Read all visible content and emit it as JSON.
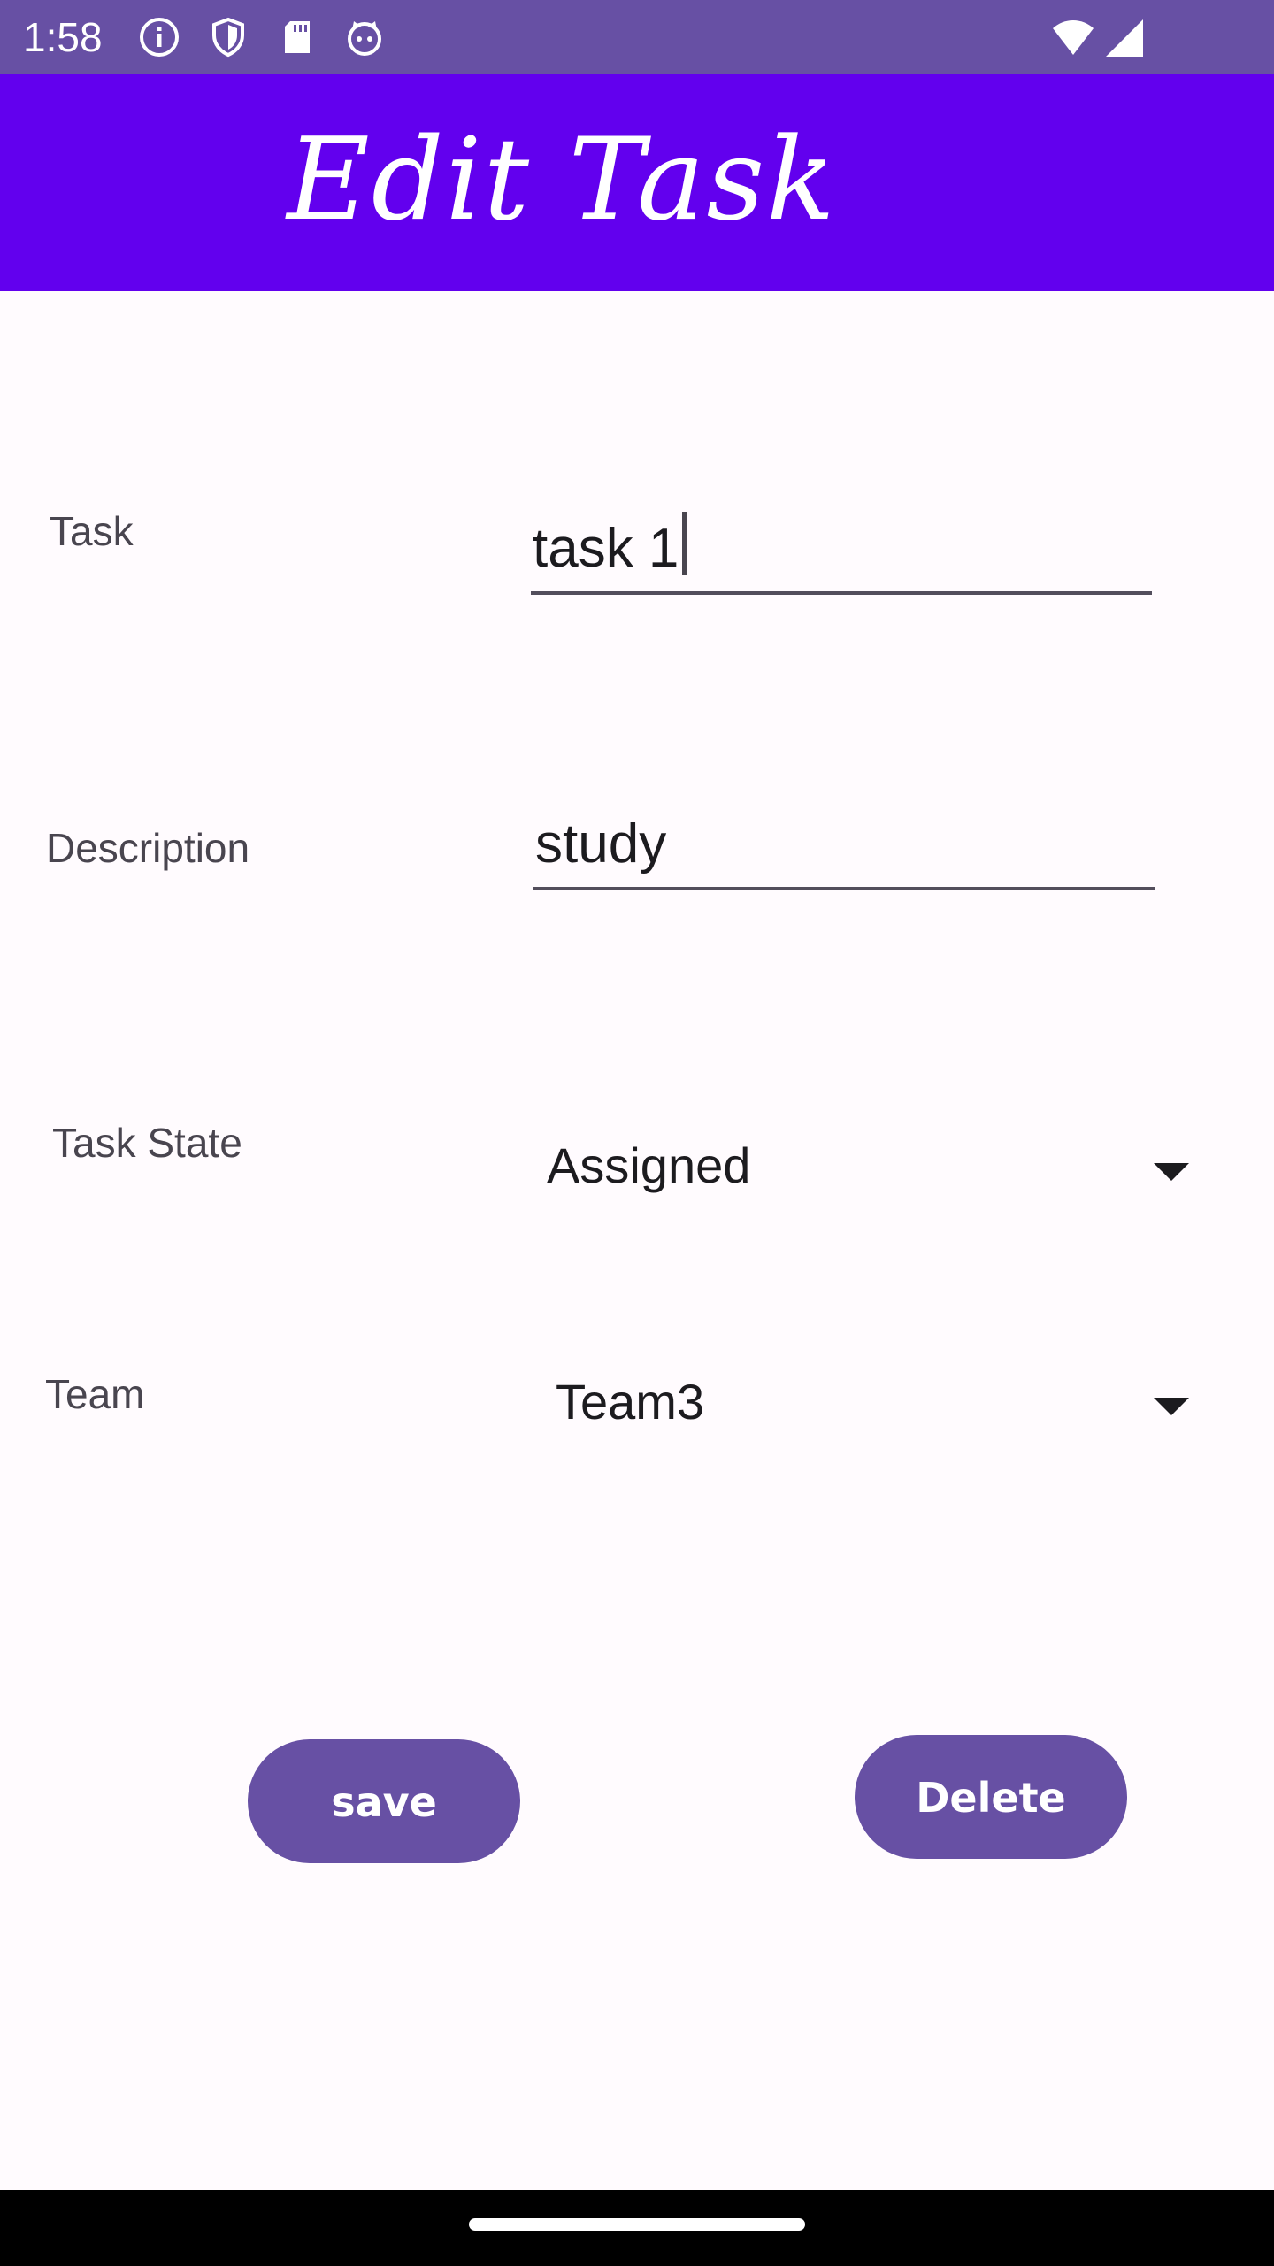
{
  "status_bar": {
    "time": "1:58",
    "left_icons": [
      "info-icon",
      "shield-icon",
      "sd-card-icon",
      "cat-face-icon"
    ],
    "right_icons": [
      "wifi-icon",
      "signal-icon"
    ],
    "bg_color": "#6750a4"
  },
  "app_bar": {
    "title": "Edit Task",
    "bg_color": "#6200ee"
  },
  "form": {
    "task": {
      "label": "Task",
      "value": "task 1"
    },
    "description": {
      "label": "Description",
      "value": "study"
    },
    "task_state": {
      "label": "Task State",
      "selected": "Assigned"
    },
    "team": {
      "label": "Team",
      "selected": "Team3"
    }
  },
  "buttons": {
    "save_label": "save",
    "delete_label": "Delete",
    "color": "#6750a4"
  }
}
